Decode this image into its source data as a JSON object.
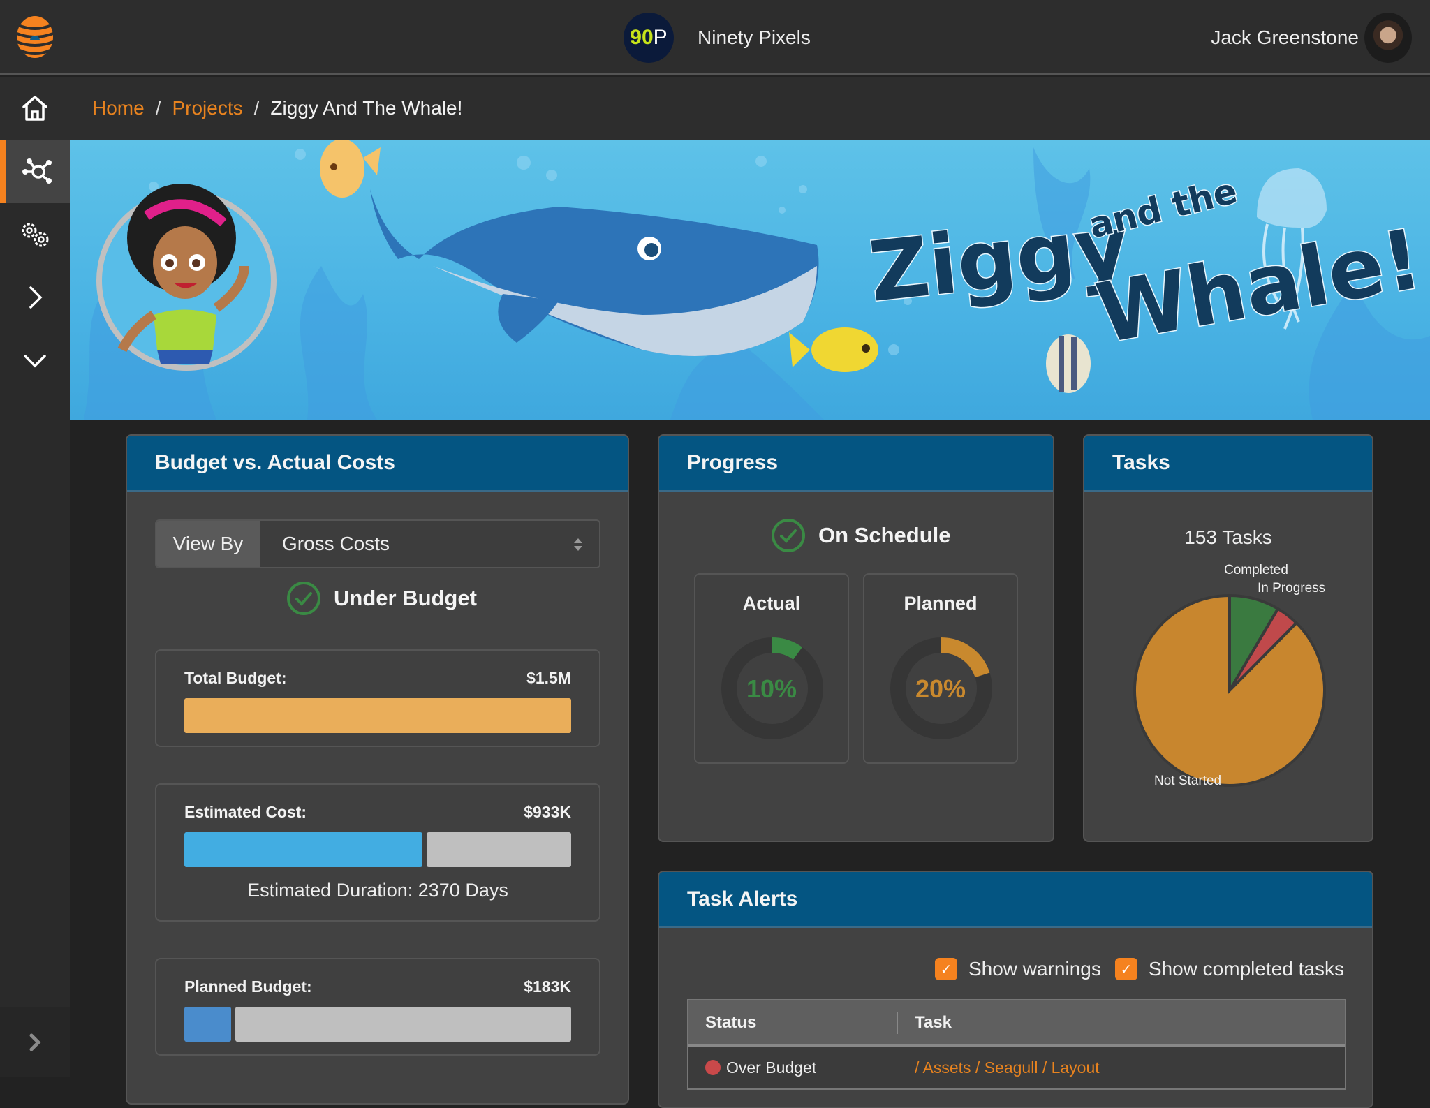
{
  "topbar": {
    "logo_icon": "beehive-logo-icon",
    "org": {
      "badge_number": "90",
      "badge_letter": "P",
      "name": "Ninety Pixels"
    },
    "user": {
      "name": "Jack Greenstone",
      "avatar_icon": "user-avatar"
    }
  },
  "breadcrumb": {
    "home_icon": "home-icon",
    "items": [
      {
        "label": "Home",
        "link": true
      },
      {
        "label": "Projects",
        "link": true
      },
      {
        "label": "Ziggy And The Whale!",
        "link": false
      }
    ],
    "separator": "/"
  },
  "sidebar": {
    "items": [
      {
        "icon": "network-nodes-icon",
        "active": true
      },
      {
        "icon": "gears-icon",
        "active": false
      },
      {
        "icon": "chevron-right-icon",
        "active": false
      },
      {
        "icon": "chevron-down-icon",
        "active": false
      }
    ],
    "footer_icon": "expand-sidebar-icon"
  },
  "banner": {
    "title_line1": "Ziggy",
    "title_small": "and the",
    "title_line2": "Whale!"
  },
  "budget": {
    "title": "Budget vs. Actual Costs",
    "view_by_label": "View By",
    "view_by_value": "Gross Costs",
    "status": "Under Budget",
    "total": {
      "label": "Total Budget:",
      "value": "$1.5M",
      "fill_fraction": 1.0,
      "color": "#eaae5a"
    },
    "estimated": {
      "label": "Estimated Cost:",
      "value": "$933K",
      "fill_fraction": 0.622,
      "color": "#42ade2",
      "note": "Estimated Duration: 2370 Days"
    },
    "planned": {
      "label": "Planned Budget:",
      "value": "$183K",
      "fill_fraction": 0.122,
      "color": "#4a8ccc"
    }
  },
  "progress": {
    "title": "Progress",
    "status": "On Schedule",
    "actual": {
      "label": "Actual",
      "value_text": "10%",
      "percent": 10,
      "color": "#3a8a44"
    },
    "planned": {
      "label": "Planned",
      "value_text": "20%",
      "percent": 20,
      "color": "#c9892e"
    }
  },
  "tasks": {
    "title": "Tasks",
    "total_text": "153 Tasks"
  },
  "chart_data": {
    "type": "pie",
    "title": "153 Tasks",
    "categories": [
      "Completed",
      "In Progress",
      "Not Started"
    ],
    "values": [
      13,
      6,
      134
    ],
    "colors": [
      "#3a7a40",
      "#c0494b",
      "#c8862e"
    ],
    "legend": "none (slice labels)"
  },
  "alerts": {
    "title": "Task Alerts",
    "checkboxes": [
      {
        "label": "Show warnings",
        "checked": true
      },
      {
        "label": "Show completed tasks",
        "checked": true
      }
    ],
    "columns": [
      "Status",
      "Task"
    ],
    "rows": [
      {
        "status": "Over Budget",
        "status_color": "#c9494a",
        "task": "/ Assets / Seagull / Layout"
      }
    ]
  },
  "colors": {
    "accent": "#f5821f",
    "card_header": "#045582",
    "success": "#3a8a44"
  }
}
